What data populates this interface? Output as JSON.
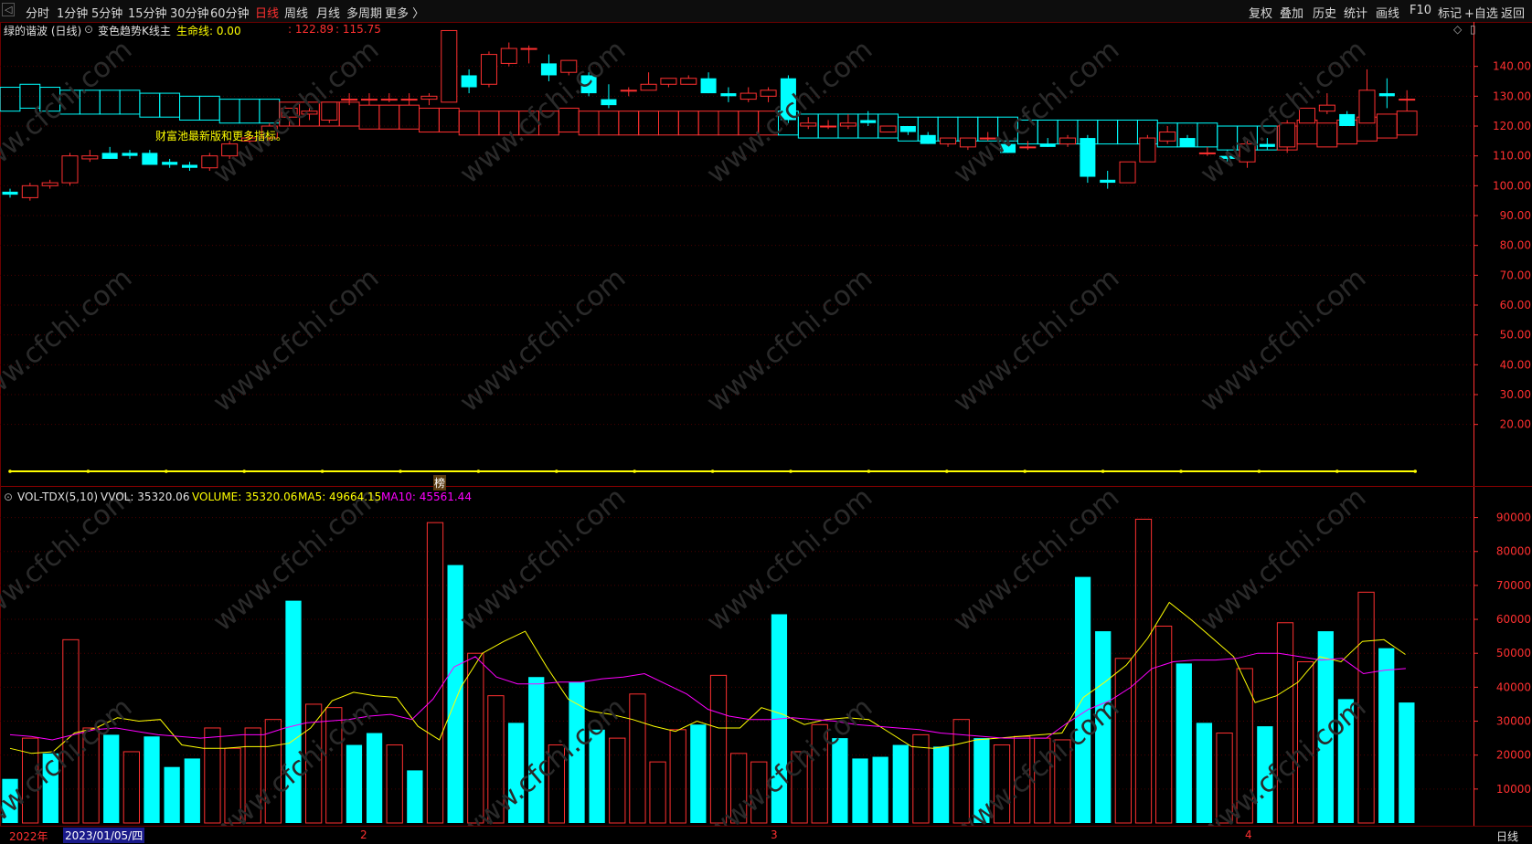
{
  "toolbar": {
    "left_items": [
      "分时",
      "1分钟",
      "5分钟",
      "15分钟",
      "30分钟",
      "60分钟",
      "日线",
      "周线",
      "月线",
      "多周期",
      "更多 〉"
    ],
    "active_index": 6,
    "right_items": [
      "复权",
      "叠加",
      "历史",
      "统计",
      "画线",
      "F10",
      "标记",
      "+自选",
      "返回"
    ]
  },
  "chart_header": {
    "stock": "绿的谐波 (日线)",
    "indicator": "变色趋势K线主",
    "life_line_label": "生命线: 0.00",
    "v1": ": 122.89",
    "v2": ": 115.75",
    "note": "财富池最新版和更多指标。"
  },
  "vol_header": {
    "name": "VOL-TDX(5,10)",
    "vvol": "VVOL: 35320.06",
    "volume": "VOLUME: 35320.06",
    "ma5": "MA5: 49664.15",
    "ma10": "MA10: 45561.44"
  },
  "marker_label": "榜",
  "bottom": {
    "year": "2022年",
    "date": "2023/01/05/四",
    "month_labels": [
      "2",
      "3",
      "4"
    ],
    "period": "日线"
  },
  "watermark": "www.cfchi.com",
  "colors": {
    "up": "#ff3030",
    "down": "#00ffff",
    "ma5": "#ffff00",
    "ma10": "#ff00ff",
    "band": "#0000ff",
    "axis": "#ff3030"
  },
  "chart_data": [
    {
      "type": "candlestick",
      "title": "绿的谐波 (日线)",
      "ylim": [
        0,
        150
      ],
      "y_ticks": [
        "20.00",
        "30.00",
        "40.00",
        "50.00",
        "60.00",
        "70.00",
        "80.00",
        "90.00",
        "100.00",
        "110.00",
        "120.00",
        "130.00",
        "140.00"
      ],
      "candles_ohlc": [
        [
          98,
          99,
          96,
          97
        ],
        [
          96,
          101,
          95,
          100
        ],
        [
          100,
          102,
          99,
          101
        ],
        [
          101,
          111,
          100,
          110
        ],
        [
          109,
          112,
          108,
          110
        ],
        [
          111,
          113,
          109,
          109
        ],
        [
          111,
          112,
          109,
          110
        ],
        [
          111,
          112,
          107,
          107
        ],
        [
          108,
          109,
          106,
          107
        ],
        [
          107,
          108,
          105,
          106
        ],
        [
          106,
          111,
          105,
          110
        ],
        [
          110,
          115,
          109,
          114
        ],
        [
          115,
          118,
          114,
          116
        ],
        [
          116,
          121,
          115,
          120
        ],
        [
          123,
          126,
          120,
          126
        ],
        [
          124,
          126,
          122,
          125
        ],
        [
          122,
          128,
          121,
          128
        ],
        [
          129,
          131,
          127,
          129
        ],
        [
          129,
          131,
          127,
          129
        ],
        [
          129,
          131,
          128,
          129
        ],
        [
          129,
          131,
          127,
          129
        ],
        [
          129,
          131,
          127,
          130
        ],
        [
          128,
          152,
          128,
          152
        ],
        [
          137,
          139,
          131,
          133
        ],
        [
          134,
          145,
          133,
          144
        ],
        [
          141,
          148,
          140,
          146
        ],
        [
          146,
          147,
          141,
          146
        ],
        [
          141,
          144,
          135,
          137
        ],
        [
          138,
          142,
          137,
          142
        ],
        [
          137,
          138,
          130,
          131
        ],
        [
          129,
          134,
          126,
          127
        ],
        [
          132,
          133,
          130,
          132
        ],
        [
          132,
          138,
          132,
          134
        ],
        [
          134,
          136,
          133,
          136
        ],
        [
          134,
          137,
          134,
          136
        ],
        [
          136,
          138,
          131,
          131
        ],
        [
          131,
          133,
          128,
          130
        ],
        [
          129,
          133,
          128,
          131
        ],
        [
          130,
          133,
          128,
          132
        ],
        [
          136,
          137,
          121,
          122
        ],
        [
          120,
          123,
          119,
          121
        ],
        [
          120,
          122,
          119,
          120
        ],
        [
          120,
          124,
          119,
          121
        ],
        [
          122,
          125,
          120,
          121
        ],
        [
          118,
          120,
          118,
          120
        ],
        [
          120,
          120,
          117,
          118
        ],
        [
          117,
          118,
          114,
          114
        ],
        [
          114,
          116,
          113,
          116
        ],
        [
          113,
          116,
          112,
          116
        ],
        [
          116,
          118,
          115,
          116
        ],
        [
          114,
          115,
          111,
          111
        ],
        [
          113,
          115,
          112,
          113
        ],
        [
          114,
          116,
          113,
          113
        ],
        [
          114,
          117,
          113,
          116
        ],
        [
          116,
          117,
          101,
          103
        ],
        [
          102,
          105,
          99,
          101
        ],
        [
          101,
          108,
          101,
          108
        ],
        [
          108,
          117,
          108,
          116
        ],
        [
          115,
          120,
          114,
          118
        ],
        [
          116,
          117,
          113,
          113
        ],
        [
          111,
          113,
          110,
          111
        ],
        [
          110,
          112,
          108,
          109
        ],
        [
          108,
          115,
          106,
          114
        ],
        [
          114,
          116,
          112,
          113
        ],
        [
          113,
          122,
          111,
          121
        ],
        [
          121,
          126,
          121,
          126
        ],
        [
          125,
          131,
          124,
          127
        ],
        [
          124,
          125,
          121,
          120
        ],
        [
          121,
          139,
          121,
          132
        ],
        [
          131,
          136,
          126,
          130
        ],
        [
          129,
          132,
          125,
          129
        ]
      ],
      "band_values": [
        129,
        130,
        129,
        128,
        128,
        128,
        128,
        127,
        127,
        126,
        126,
        125,
        125,
        125,
        124,
        124,
        124,
        124,
        123,
        123,
        123,
        122,
        122,
        121,
        121,
        121,
        121,
        121,
        122,
        121,
        121,
        121,
        121,
        121,
        121,
        121,
        121,
        121,
        121,
        121,
        120,
        120,
        120,
        120,
        120,
        119,
        119,
        119,
        119,
        119,
        119,
        118,
        118,
        118,
        118,
        118,
        118,
        118,
        117,
        117,
        117,
        116,
        116,
        116,
        116,
        118,
        117,
        118,
        119,
        120,
        121
      ],
      "band_colors": [
        "down",
        "down",
        "down",
        "down",
        "down",
        "down",
        "down",
        "down",
        "down",
        "down",
        "down",
        "down",
        "down",
        "down",
        "up",
        "up",
        "up",
        "up",
        "up",
        "up",
        "up",
        "up",
        "up",
        "up",
        "up",
        "up",
        "up",
        "up",
        "up",
        "up",
        "up",
        "up",
        "up",
        "up",
        "up",
        "up",
        "up",
        "up",
        "up",
        "down",
        "down",
        "down",
        "down",
        "down",
        "down",
        "down",
        "down",
        "down",
        "down",
        "down",
        "down",
        "down",
        "down",
        "down",
        "down",
        "down",
        "down",
        "down",
        "down",
        "down",
        "down",
        "down",
        "down",
        "down",
        "up",
        "up",
        "up",
        "up",
        "up",
        "up",
        "up"
      ],
      "life_line": 0
    },
    {
      "type": "bar",
      "title": "VOL-TDX(5,10)",
      "ylim": [
        0,
        95000
      ],
      "y_ticks": [
        "10000",
        "20000",
        "30000",
        "40000",
        "50000",
        "60000",
        "70000",
        "80000",
        "90000"
      ],
      "values": [
        13000,
        25000,
        20500,
        54000,
        28000,
        26000,
        21000,
        25500,
        16500,
        19000,
        28000,
        22000,
        28000,
        30500,
        65500,
        35000,
        34000,
        23000,
        26500,
        23000,
        15500,
        88500,
        76000,
        50000,
        37500,
        29500,
        43000,
        23000,
        41500,
        27500,
        25000,
        38000,
        18000,
        27500,
        29000,
        43500,
        20500,
        18000,
        61500,
        21000,
        29000,
        25000,
        19000,
        19500,
        23000,
        26000,
        22500,
        30500,
        25000,
        23000,
        25500,
        25000,
        24500,
        72500,
        56500,
        48500,
        89500,
        58000,
        47000,
        29500,
        26500,
        45500,
        28500,
        59000,
        47500,
        56500,
        36500,
        68000,
        51500,
        35500
      ],
      "value_colors": [
        "down",
        "up",
        "down",
        "up",
        "up",
        "down",
        "up",
        "down",
        "down",
        "down",
        "up",
        "up",
        "up",
        "up",
        "down",
        "up",
        "up",
        "down",
        "down",
        "up",
        "down",
        "up",
        "down",
        "up",
        "up",
        "down",
        "down",
        "up",
        "down",
        "down",
        "up",
        "up",
        "up",
        "up",
        "down",
        "up",
        "up",
        "up",
        "down",
        "up",
        "up",
        "down",
        "down",
        "down",
        "down",
        "up",
        "down",
        "up",
        "down",
        "up",
        "up",
        "up",
        "up",
        "down",
        "down",
        "up",
        "up",
        "up",
        "down",
        "down",
        "up",
        "up",
        "down",
        "up",
        "up",
        "down",
        "down",
        "up",
        "down",
        "down"
      ],
      "series": [
        {
          "name": "MA5",
          "values": [
            22000,
            20500,
            21000,
            26500,
            28000,
            31000,
            30000,
            30500,
            23000,
            22000,
            22000,
            22500,
            22500,
            23500,
            28000,
            36000,
            38500,
            37500,
            37000,
            28500,
            24500,
            40000,
            50000,
            53500,
            56500,
            46000,
            36500,
            33000,
            32000,
            30500,
            28500,
            27000,
            30000,
            28000,
            28000,
            34000,
            32000,
            29000,
            30500,
            31000,
            30500,
            26500,
            22500,
            22000,
            23000,
            24500,
            25000,
            25500,
            26000,
            26500,
            37000,
            41500,
            46500,
            54500,
            65000,
            60000,
            54500,
            49000,
            35500,
            37500,
            41500,
            49000,
            47500,
            53500,
            54000,
            49664
          ]
        },
        {
          "name": "MA10",
          "values": [
            26000,
            25500,
            24500,
            26000,
            27500,
            28000,
            27000,
            26000,
            25500,
            25000,
            25500,
            26000,
            26000,
            28000,
            29500,
            30000,
            30500,
            31500,
            32000,
            30500,
            36500,
            46000,
            49000,
            43000,
            41000,
            41000,
            41500,
            41500,
            42500,
            43000,
            44000,
            41000,
            38000,
            33500,
            31500,
            30500,
            30500,
            31000,
            30500,
            30000,
            29000,
            28500,
            28000,
            27500,
            26500,
            26000,
            25500,
            25000,
            25000,
            25000,
            29500,
            33500,
            36000,
            40000,
            45500,
            47500,
            48000,
            48000,
            48500,
            50000,
            50000,
            49000,
            48000,
            48500,
            44000,
            45000,
            45500
          ]
        }
      ]
    }
  ]
}
